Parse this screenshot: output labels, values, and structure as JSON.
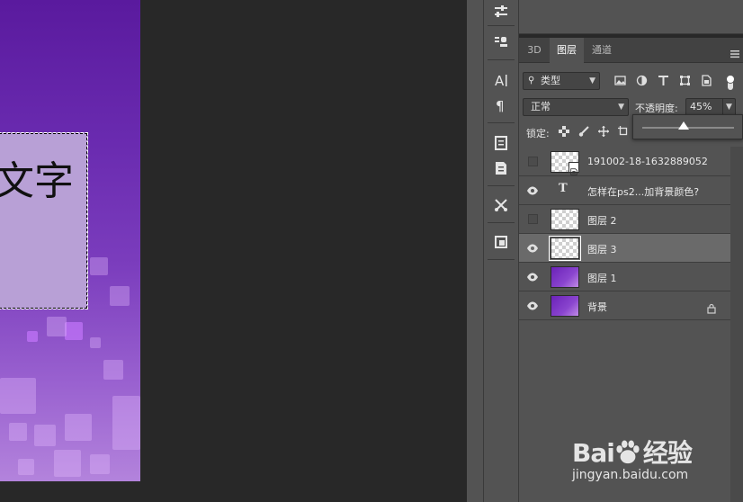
{
  "canvas": {
    "text": "文字"
  },
  "panel": {
    "tabs": [
      {
        "label": "3D",
        "active": false
      },
      {
        "label": "图层",
        "active": true
      },
      {
        "label": "通道",
        "active": false
      }
    ],
    "filter": {
      "label": "类型"
    },
    "blend_mode": {
      "value": "正常"
    },
    "opacity": {
      "label": "不透明度:",
      "value": "45%",
      "fraction": 0.45
    },
    "lock": {
      "label": "锁定:"
    }
  },
  "layers": [
    {
      "name": "191002-18-1632889052",
      "visible": false,
      "thumb": "checker-smart",
      "selected": false,
      "locked": false
    },
    {
      "name": "怎样在ps2...加背景颜色?",
      "visible": true,
      "thumb": "type",
      "selected": false,
      "locked": false
    },
    {
      "name": "图层 2",
      "visible": false,
      "thumb": "checker",
      "selected": false,
      "locked": false
    },
    {
      "name": "图层 3",
      "visible": true,
      "thumb": "checker",
      "selected": true,
      "locked": false
    },
    {
      "name": "图层 1",
      "visible": true,
      "thumb": "purple",
      "selected": false,
      "locked": false
    },
    {
      "name": "背景",
      "visible": true,
      "thumb": "purple",
      "selected": false,
      "locked": true
    }
  ],
  "watermark": {
    "logo_left": "Bai",
    "logo_right": "经验",
    "sub": "jingyan.baidu.com"
  },
  "colors": {
    "panel_bg": "#535353",
    "selected_row": "#6a6a6a",
    "workspace": "#282828",
    "canvas_purple": "#6a2bb0"
  }
}
